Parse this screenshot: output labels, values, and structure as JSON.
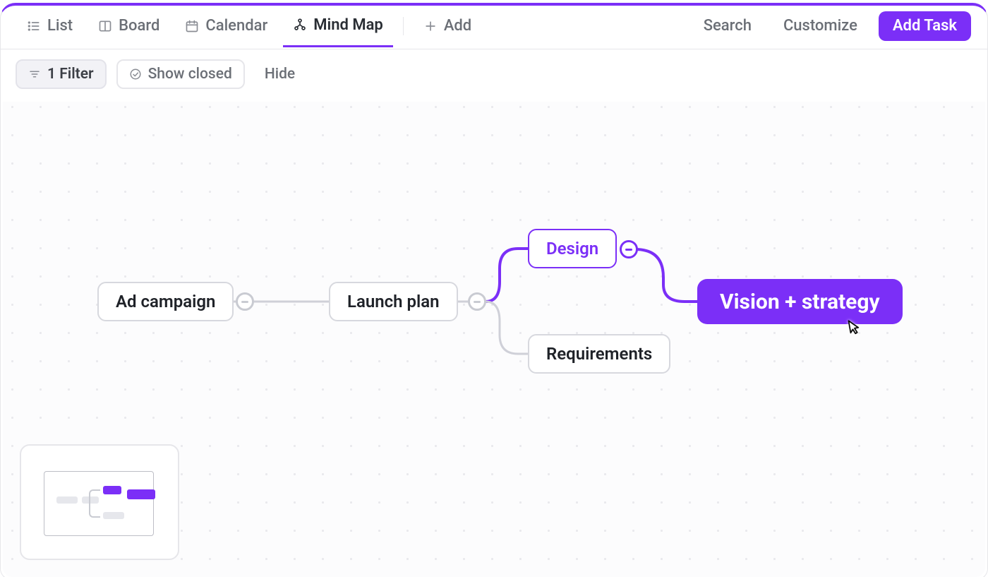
{
  "tabs": {
    "list": "List",
    "board": "Board",
    "calendar": "Calendar",
    "mindmap": "Mind Map",
    "add": "Add"
  },
  "top_actions": {
    "search": "Search",
    "customize": "Customize",
    "add_task": "Add Task"
  },
  "filters": {
    "filter_chip": "1 Filter",
    "show_closed": "Show closed",
    "hide": "Hide"
  },
  "nodes": {
    "ad_campaign": "Ad campaign",
    "launch_plan": "Launch plan",
    "design": "Design",
    "requirements": "Requirements",
    "vision_strategy": "Vision + strategy"
  }
}
